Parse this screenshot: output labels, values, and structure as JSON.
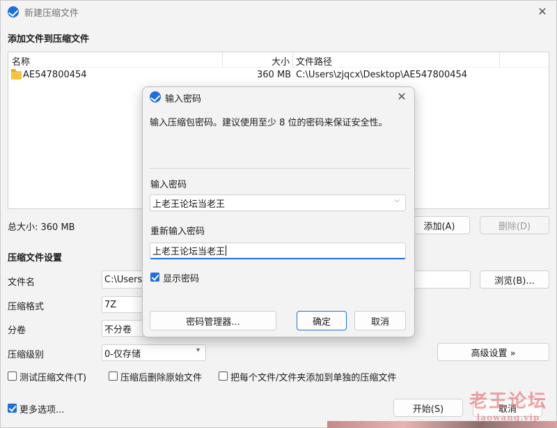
{
  "main": {
    "title": "新建压缩文件",
    "add_files_heading": "添加文件到压缩文件",
    "columns": {
      "name": "名称",
      "size": "大小",
      "path": "文件路径"
    },
    "files": [
      {
        "name": "AE547800454",
        "size": "360 MB",
        "path": "C:\\Users\\zjqcx\\Desktop\\AE547800454"
      }
    ],
    "total_size": "总大小: 360 MB",
    "add_button": "添加(A)",
    "delete_button": "删除(D)",
    "settings_heading": "压缩文件设置",
    "filename_label": "文件名",
    "filename_value": "C:\\Users\\",
    "browse_button": "浏览(B)...",
    "format_label": "压缩格式",
    "format_value": "7Z",
    "split_label": "分卷",
    "split_value": "不分卷",
    "level_label": "压缩级别",
    "level_value": "0-仅存储",
    "advanced_button": "高级设置 »",
    "test_checkbox": "测试压缩文件(T)",
    "delete_after_checkbox": "压缩后删除原始文件",
    "separate_checkbox": "把每个文件/文件夹添加到单独的压缩文件",
    "more_options": "更多选项...",
    "start_button": "开始(S)",
    "cancel_button": "取消"
  },
  "dialog": {
    "title": "输入密码",
    "description": "输入压缩包密码。建议使用至少 8 位的密码来保证安全性。",
    "password_label": "输入密码",
    "password_value": "上老王论坛当老王",
    "confirm_label": "重新输入密码",
    "confirm_value": "上老王论坛当老王",
    "show_password": "显示密码",
    "manager_button": "密码管理器...",
    "ok_button": "确定",
    "cancel_button": "取消"
  },
  "watermark": {
    "line1": "老王论坛",
    "line2": "laowang.vip"
  },
  "colors": {
    "accent": "#1e6fd9",
    "watermark": "#e55a60"
  }
}
